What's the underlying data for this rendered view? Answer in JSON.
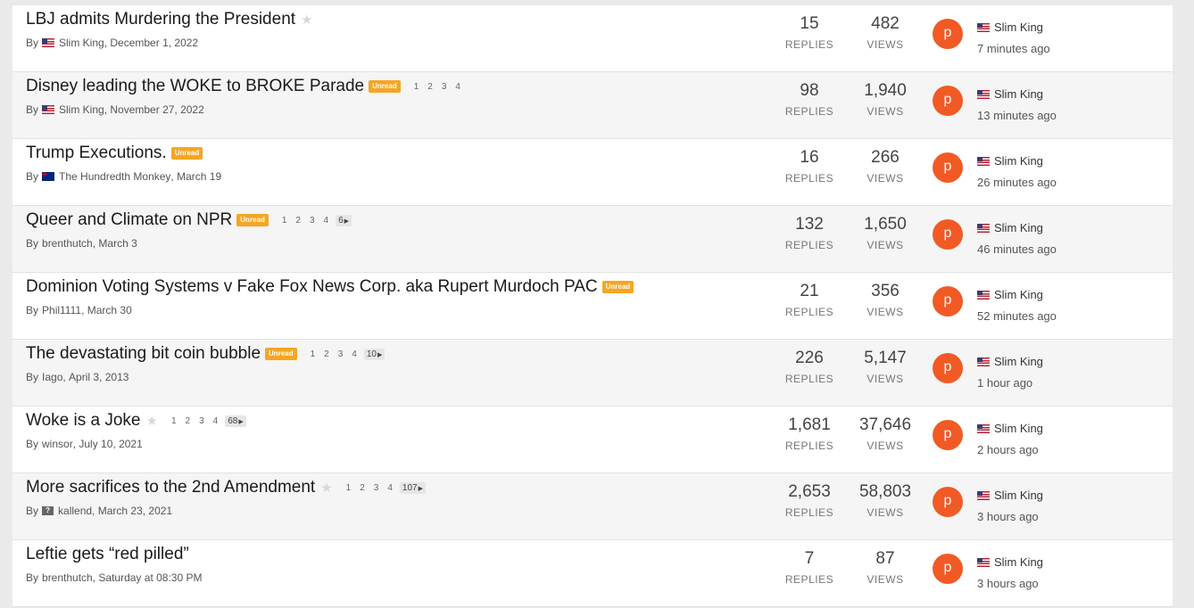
{
  "labels": {
    "by": "By",
    "replies": "REPLIES",
    "views": "VIEWS",
    "unread": "Unread"
  },
  "topics": [
    {
      "title": "LBJ admits Murdering the President",
      "author": "Slim King",
      "author_flag": "us",
      "date": "December 1, 2022",
      "replies": "15",
      "views": "482",
      "last_poster": "Slim King",
      "last_time": "7 minutes ago",
      "avatar_letter": "p",
      "starred_icon": true
    },
    {
      "title": "Disney leading the WOKE to BROKE Parade",
      "author": "Slim King",
      "author_flag": "us",
      "date": "November 27, 2022",
      "unread": true,
      "pages": [
        "1",
        "2",
        "3",
        "4"
      ],
      "replies": "98",
      "views": "1,940",
      "last_poster": "Slim King",
      "last_time": "13 minutes ago",
      "avatar_letter": "p"
    },
    {
      "title": "Trump Executions.",
      "author": "The Hundredth Monkey",
      "author_flag": "nz",
      "date": "March 19",
      "unread": true,
      "replies": "16",
      "views": "266",
      "last_poster": "Slim King",
      "last_time": "26 minutes ago",
      "avatar_letter": "p"
    },
    {
      "title": "Queer and Climate on NPR",
      "author": "brenthutch",
      "date": "March 3",
      "unread": true,
      "pages": [
        "1",
        "2",
        "3",
        "4"
      ],
      "last_page": "6",
      "replies": "132",
      "views": "1,650",
      "last_poster": "Slim King",
      "last_time": "46 minutes ago",
      "avatar_letter": "p"
    },
    {
      "title": "Dominion Voting Systems v Fake Fox News Corp. aka Rupert Murdoch PAC",
      "author": "Phil1111",
      "date": "March 30",
      "unread": true,
      "replies": "21",
      "views": "356",
      "last_poster": "Slim King",
      "last_time": "52 minutes ago",
      "avatar_letter": "p"
    },
    {
      "title": "The devastating bit coin bubble",
      "author": "Iago",
      "date": "April 3, 2013",
      "unread": true,
      "pages": [
        "1",
        "2",
        "3",
        "4"
      ],
      "last_page": "10",
      "replies": "226",
      "views": "5,147",
      "last_poster": "Slim King",
      "last_time": "1 hour ago",
      "avatar_letter": "p"
    },
    {
      "title": "Woke is a Joke",
      "author": "winsor",
      "date": "July 10, 2021",
      "starred_icon": true,
      "pages": [
        "1",
        "2",
        "3",
        "4"
      ],
      "last_page": "68",
      "replies": "1,681",
      "views": "37,646",
      "last_poster": "Slim King",
      "last_time": "2 hours ago",
      "avatar_letter": "p"
    },
    {
      "title": "More sacrifices to the 2nd Amendment",
      "author": "kallend",
      "author_flag": "unknown",
      "date": "March 23, 2021",
      "starred_icon": true,
      "pages": [
        "1",
        "2",
        "3",
        "4"
      ],
      "last_page": "107",
      "replies": "2,653",
      "views": "58,803",
      "last_poster": "Slim King",
      "last_time": "3 hours ago",
      "avatar_letter": "p"
    },
    {
      "title": "Leftie gets “red pilled”",
      "author": "brenthutch",
      "date": "Saturday at 08:30 PM",
      "replies": "7",
      "views": "87",
      "last_poster": "Slim King",
      "last_time": "3 hours ago",
      "avatar_letter": "p"
    }
  ]
}
